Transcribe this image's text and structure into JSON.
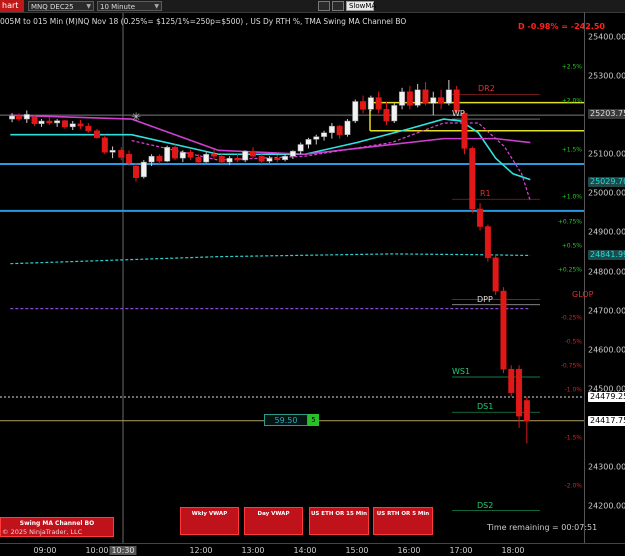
{
  "toolbar": {
    "chart_tab": "hart",
    "instrument": "MNQ DEC25",
    "interval": "10 Minute",
    "slow_ma": "SlowMA"
  },
  "chart_title": "005M to 015 Min (M)NQ Nov 18 (0.25%= $125/1%=250p=$500) , US Dy RTH %, TMA Swing MA Channel BO",
  "pnl": "D -0.98% = -242.50",
  "price_axis": {
    "labels": [
      {
        "text": "25400.00",
        "price": 25400
      },
      {
        "text": "25300.00",
        "price": 25300
      },
      {
        "text": "25100.00",
        "price": 25100
      },
      {
        "text": "25000.00",
        "price": 25000
      },
      {
        "text": "24900.00",
        "price": 24900
      },
      {
        "text": "24800.00",
        "price": 24800
      },
      {
        "text": "24700.00",
        "price": 24700
      },
      {
        "text": "24600.00",
        "price": 24600
      },
      {
        "text": "24500.00",
        "price": 24500
      },
      {
        "text": "24300.00",
        "price": 24300
      },
      {
        "text": "24200.00",
        "price": 24200
      }
    ],
    "tags": [
      {
        "text": "25203.75",
        "price": 25203.75,
        "bg": "#3a3a3a",
        "fg": "#dddddd"
      },
      {
        "text": "25029.70",
        "price": 25029.7,
        "bg": "#1e4a4a",
        "fg": "#22dddd"
      },
      {
        "text": "24841.99",
        "price": 24841.99,
        "bg": "#1e4a4a",
        "fg": "#22dddd"
      },
      {
        "text": "24479.25",
        "price": 24479.25,
        "bg": "#ffffff",
        "fg": "#000000"
      },
      {
        "text": "24417.75",
        "price": 24417.75,
        "bg": "#ffffff",
        "fg": "#000000"
      }
    ]
  },
  "percent_labels": [
    {
      "text": "+2.5%",
      "price": 25322,
      "color": "#22cc22"
    },
    {
      "text": "+2.0%",
      "price": 25235,
      "color": "#22cc22"
    },
    {
      "text": "+1.5%",
      "price": 25112,
      "color": "#22cc22"
    },
    {
      "text": "+1.0%",
      "price": 24990,
      "color": "#22cc22"
    },
    {
      "text": "+0.75%",
      "price": 24927,
      "color": "#22cc22"
    },
    {
      "text": "+0.5%",
      "price": 24865,
      "color": "#22cc22"
    },
    {
      "text": "+0.25%",
      "price": 24803,
      "color": "#22cc22"
    },
    {
      "text": "-0.25%",
      "price": 24682,
      "color": "#dd2222"
    },
    {
      "text": "-0.5%",
      "price": 24619,
      "color": "#dd2222"
    },
    {
      "text": "-0.75%",
      "price": 24557,
      "color": "#dd2222"
    },
    {
      "text": "-1.0%",
      "price": 24497,
      "color": "#dd2222"
    },
    {
      "text": "-1.5%",
      "price": 24374,
      "color": "#dd2222"
    },
    {
      "text": "-2.0%",
      "price": 24251,
      "color": "#dd2222"
    }
  ],
  "levels": [
    {
      "text": "DR2",
      "price": 25253,
      "color": "#dd3333"
    },
    {
      "text": "WP",
      "price": 25190,
      "color": "#dddddd"
    },
    {
      "text": "R1",
      "price": 24985,
      "color": "#dd3333"
    },
    {
      "text": "GLOP",
      "price": 24728,
      "color": "#dd3333"
    },
    {
      "text": "DPP",
      "price": 24715,
      "color": "#dddddd"
    },
    {
      "text": "WS1",
      "price": 24530,
      "color": "#22cc77"
    },
    {
      "text": "DS1",
      "price": 24440,
      "color": "#22cc77"
    },
    {
      "text": "DS2",
      "price": 24188,
      "color": "#22cc77"
    }
  ],
  "time_axis": {
    "labels": [
      {
        "text": "09:00",
        "t": 0
      },
      {
        "text": "10:00",
        "t": 6
      },
      {
        "text": "10:30",
        "t": 9,
        "crosshair": true
      },
      {
        "text": "12:00",
        "t": 18
      },
      {
        "text": "13:00",
        "t": 24
      },
      {
        "text": "14:00",
        "t": 30
      },
      {
        "text": "15:00",
        "t": 36
      },
      {
        "text": "16:00",
        "t": 42
      },
      {
        "text": "17:00",
        "t": 48
      },
      {
        "text": "18:00",
        "t": 54
      }
    ]
  },
  "buttons": [
    {
      "label": "Wkly VWAP"
    },
    {
      "label": "Day VWAP"
    },
    {
      "label": "US ETH OR 15 Min"
    },
    {
      "label": "US RTH OR 5 Min"
    }
  ],
  "ma_button": "Swing MA Channel BO",
  "copyright": "© 2025 NinjaTrader, LLC",
  "time_remaining": "Time remaining = 00:07:51",
  "qty": {
    "value": "59.50",
    "marker": "5"
  },
  "chart_data": {
    "type": "candlestick",
    "instrument": "MNQ DEC25",
    "interval": "10 Minute",
    "candles": [
      {
        "t": -3.8,
        "o": 25190,
        "h": 25205,
        "l": 25182,
        "c": 25198
      },
      {
        "t": -3.0,
        "o": 25198,
        "h": 25205,
        "l": 25185,
        "c": 25190
      },
      {
        "t": -2.1,
        "o": 25190,
        "h": 25212,
        "l": 25180,
        "c": 25202
      },
      {
        "t": -1.2,
        "o": 25195,
        "h": 25200,
        "l": 25172,
        "c": 25178
      },
      {
        "t": -0.4,
        "o": 25178,
        "h": 25190,
        "l": 25170,
        "c": 25185
      },
      {
        "t": 0.5,
        "o": 25185,
        "h": 25195,
        "l": 25175,
        "c": 25180
      },
      {
        "t": 1.4,
        "o": 25180,
        "h": 25190,
        "l": 25170,
        "c": 25186
      },
      {
        "t": 2.3,
        "o": 25186,
        "h": 25188,
        "l": 25165,
        "c": 25170
      },
      {
        "t": 3.2,
        "o": 25170,
        "h": 25185,
        "l": 25162,
        "c": 25178
      },
      {
        "t": 4.1,
        "o": 25178,
        "h": 25188,
        "l": 25165,
        "c": 25172
      },
      {
        "t": 5.0,
        "o": 25172,
        "h": 25180,
        "l": 25155,
        "c": 25160
      },
      {
        "t": 6.0,
        "o": 25160,
        "h": 25165,
        "l": 25140,
        "c": 25142
      },
      {
        "t": 6.9,
        "o": 25142,
        "h": 25150,
        "l": 25100,
        "c": 25105
      },
      {
        "t": 7.8,
        "o": 25105,
        "h": 25120,
        "l": 25090,
        "c": 25110
      },
      {
        "t": 8.8,
        "o": 25110,
        "h": 25118,
        "l": 25085,
        "c": 25092
      },
      {
        "t": 9.7,
        "o": 25100,
        "h": 25110,
        "l": 25070,
        "c": 25078
      },
      {
        "t": 10.5,
        "o": 25070,
        "h": 25078,
        "l": 25030,
        "c": 25040
      },
      {
        "t": 11.4,
        "o": 25042,
        "h": 25085,
        "l": 25038,
        "c": 25080
      },
      {
        "t": 12.3,
        "o": 25080,
        "h": 25100,
        "l": 25070,
        "c": 25095
      },
      {
        "t": 13.2,
        "o": 25095,
        "h": 25100,
        "l": 25075,
        "c": 25082
      },
      {
        "t": 14.1,
        "o": 25082,
        "h": 25122,
        "l": 25080,
        "c": 25118
      },
      {
        "t": 15.0,
        "o": 25118,
        "h": 25125,
        "l": 25085,
        "c": 25090
      },
      {
        "t": 15.9,
        "o": 25090,
        "h": 25110,
        "l": 25080,
        "c": 25105
      },
      {
        "t": 16.8,
        "o": 25105,
        "h": 25112,
        "l": 25085,
        "c": 25092
      },
      {
        "t": 17.7,
        "o": 25092,
        "h": 25100,
        "l": 25075,
        "c": 25080
      },
      {
        "t": 18.6,
        "o": 25080,
        "h": 25105,
        "l": 25078,
        "c": 25100
      },
      {
        "t": 19.5,
        "o": 25100,
        "h": 25112,
        "l": 25088,
        "c": 25095
      },
      {
        "t": 20.4,
        "o": 25095,
        "h": 25100,
        "l": 25075,
        "c": 25080
      },
      {
        "t": 21.3,
        "o": 25080,
        "h": 25095,
        "l": 25072,
        "c": 25090
      },
      {
        "t": 22.2,
        "o": 25090,
        "h": 25100,
        "l": 25080,
        "c": 25085
      },
      {
        "t": 23.1,
        "o": 25085,
        "h": 25110,
        "l": 25080,
        "c": 25108
      },
      {
        "t": 24.0,
        "o": 25108,
        "h": 25118,
        "l": 25090,
        "c": 25095
      },
      {
        "t": 25.0,
        "o": 25095,
        "h": 25100,
        "l": 25075,
        "c": 25082
      },
      {
        "t": 25.9,
        "o": 25082,
        "h": 25095,
        "l": 25078,
        "c": 25090
      },
      {
        "t": 26.8,
        "o": 25090,
        "h": 25098,
        "l": 25080,
        "c": 25086
      },
      {
        "t": 27.7,
        "o": 25086,
        "h": 25100,
        "l": 25082,
        "c": 25095
      },
      {
        "t": 28.6,
        "o": 25095,
        "h": 25110,
        "l": 25088,
        "c": 25108
      },
      {
        "t": 29.5,
        "o": 25108,
        "h": 25130,
        "l": 25100,
        "c": 25125
      },
      {
        "t": 30.4,
        "o": 25125,
        "h": 25142,
        "l": 25115,
        "c": 25138
      },
      {
        "t": 31.3,
        "o": 25138,
        "h": 25150,
        "l": 25125,
        "c": 25145
      },
      {
        "t": 32.2,
        "o": 25145,
        "h": 25160,
        "l": 25135,
        "c": 25155
      },
      {
        "t": 33.1,
        "o": 25155,
        "h": 25180,
        "l": 25140,
        "c": 25172
      },
      {
        "t": 34.0,
        "o": 25172,
        "h": 25175,
        "l": 25140,
        "c": 25150
      },
      {
        "t": 34.9,
        "o": 25150,
        "h": 25190,
        "l": 25145,
        "c": 25185
      },
      {
        "t": 35.8,
        "o": 25185,
        "h": 25240,
        "l": 25180,
        "c": 25235
      },
      {
        "t": 36.7,
        "o": 25235,
        "h": 25250,
        "l": 25205,
        "c": 25215
      },
      {
        "t": 37.6,
        "o": 25215,
        "h": 25250,
        "l": 25210,
        "c": 25245
      },
      {
        "t": 38.5,
        "o": 25245,
        "h": 25260,
        "l": 25205,
        "c": 25215
      },
      {
        "t": 39.4,
        "o": 25215,
        "h": 25235,
        "l": 25175,
        "c": 25185
      },
      {
        "t": 40.3,
        "o": 25185,
        "h": 25230,
        "l": 25180,
        "c": 25225
      },
      {
        "t": 41.2,
        "o": 25225,
        "h": 25270,
        "l": 25215,
        "c": 25260
      },
      {
        "t": 42.1,
        "o": 25260,
        "h": 25275,
        "l": 25215,
        "c": 25225
      },
      {
        "t": 43.0,
        "o": 25225,
        "h": 25280,
        "l": 25220,
        "c": 25265
      },
      {
        "t": 43.9,
        "o": 25265,
        "h": 25285,
        "l": 25225,
        "c": 25230
      },
      {
        "t": 44.8,
        "o": 25230,
        "h": 25260,
        "l": 25200,
        "c": 25245
      },
      {
        "t": 45.7,
        "o": 25245,
        "h": 25265,
        "l": 25215,
        "c": 25230
      },
      {
        "t": 46.6,
        "o": 25230,
        "h": 25290,
        "l": 25225,
        "c": 25265
      },
      {
        "t": 47.5,
        "o": 25265,
        "h": 25275,
        "l": 25205,
        "c": 25210
      },
      {
        "t": 48.4,
        "o": 25205,
        "h": 25210,
        "l": 25100,
        "c": 25115
      },
      {
        "t": 49.3,
        "o": 25115,
        "h": 25120,
        "l": 24950,
        "c": 24960
      },
      {
        "t": 50.2,
        "o": 24960,
        "h": 24975,
        "l": 24905,
        "c": 24915
      },
      {
        "t": 51.1,
        "o": 24915,
        "h": 24920,
        "l": 24825,
        "c": 24835
      },
      {
        "t": 52.0,
        "o": 24835,
        "h": 24840,
        "l": 24740,
        "c": 24750
      },
      {
        "t": 52.9,
        "o": 24750,
        "h": 24760,
        "l": 24540,
        "c": 24550
      },
      {
        "t": 53.8,
        "o": 24550,
        "h": 24560,
        "l": 24480,
        "c": 24490
      },
      {
        "t": 54.7,
        "o": 24550,
        "h": 24560,
        "l": 24400,
        "c": 24430
      },
      {
        "t": 55.6,
        "o": 24470,
        "h": 24480,
        "l": 24360,
        "c": 24418
      }
    ],
    "horizontal_lines": [
      {
        "price": 25200,
        "color": "#7a7a7a"
      },
      {
        "price": 25075,
        "color": "#2a9ae0"
      },
      {
        "price": 24955,
        "color": "#2a9ae0"
      },
      {
        "price": 24479,
        "color": "#dddddd"
      },
      {
        "price": 24418,
        "color": "#b0a060"
      }
    ],
    "vertical_crosshair_t": 9,
    "series": [
      {
        "name": "Fast MA",
        "color": "#30e0e0",
        "points": [
          [
            -4,
            25150
          ],
          [
            10,
            25150
          ],
          [
            20,
            25100
          ],
          [
            30,
            25100
          ],
          [
            36,
            25130
          ],
          [
            42,
            25165
          ],
          [
            46,
            25190
          ],
          [
            48,
            25185
          ],
          [
            50,
            25155
          ],
          [
            52,
            25090
          ],
          [
            54,
            25050
          ],
          [
            56,
            25035
          ]
        ]
      },
      {
        "name": "Slow MA",
        "color": "#d040d0",
        "points": [
          [
            -4,
            25200
          ],
          [
            10,
            25190
          ],
          [
            20,
            25110
          ],
          [
            30,
            25100
          ],
          [
            38,
            25120
          ],
          [
            46,
            25140
          ],
          [
            52,
            25140
          ],
          [
            56,
            25130
          ]
        ]
      },
      {
        "name": "Swing MA Lower",
        "color": "#dd44dd",
        "points": [
          [
            10,
            25135
          ],
          [
            15,
            25110
          ],
          [
            20,
            25085
          ],
          [
            30,
            25095
          ],
          [
            40,
            25130
          ],
          [
            46,
            25180
          ],
          [
            50,
            25180
          ],
          [
            53,
            25120
          ],
          [
            55,
            25050
          ],
          [
            56,
            24980
          ]
        ]
      },
      {
        "name": "Mid VWAP",
        "color": "#30d0d0",
        "points": [
          [
            -4,
            24820
          ],
          [
            20,
            24838
          ],
          [
            40,
            24845
          ],
          [
            50,
            24843
          ],
          [
            56,
            24841
          ]
        ]
      },
      {
        "name": "Lower Purple",
        "color": "#8a4ad0",
        "points": [
          [
            -4,
            24705
          ],
          [
            56,
            24705
          ]
        ]
      }
    ],
    "yellow_box": {
      "t0": 37.5,
      "t1": 56,
      "price_top": 25232,
      "price_bottom": 25160
    },
    "ylim": [
      24175,
      25425
    ],
    "xlim": [
      -4,
      58
    ]
  }
}
